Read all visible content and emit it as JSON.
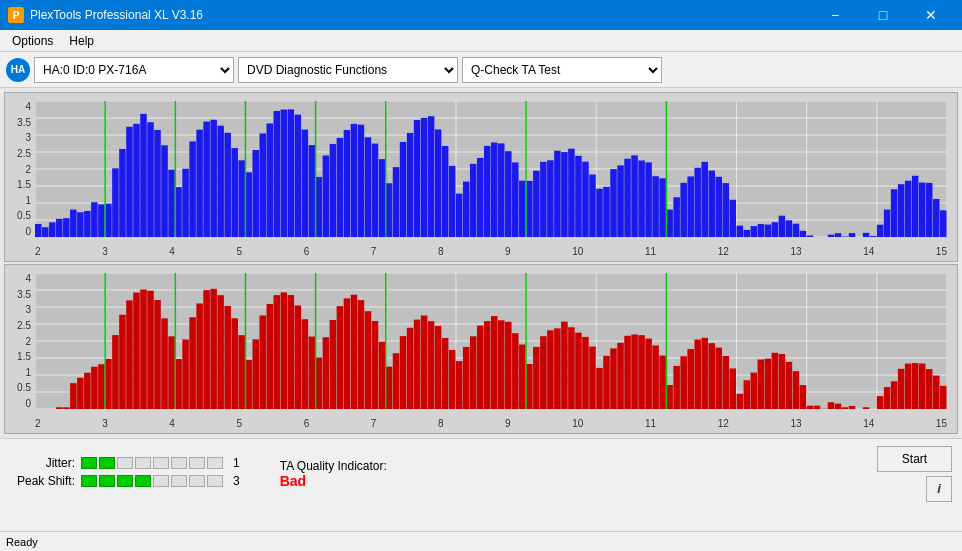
{
  "titleBar": {
    "title": "PlexTools Professional XL V3.16",
    "icon": "P",
    "minimizeLabel": "−",
    "maximizeLabel": "□",
    "closeLabel": "✕"
  },
  "menuBar": {
    "items": [
      "Options",
      "Help"
    ]
  },
  "toolbar": {
    "driveLabel": "HA:0 ID:0  PX-716A",
    "functionLabel": "DVD Diagnostic Functions",
    "testLabel": "Q-Check TA Test"
  },
  "charts": {
    "blue": {
      "yLabels": [
        "4",
        "3.5",
        "3",
        "2.5",
        "2",
        "1.5",
        "1",
        "0.5",
        "0"
      ],
      "xLabels": [
        "2",
        "3",
        "4",
        "5",
        "6",
        "7",
        "8",
        "9",
        "10",
        "11",
        "12",
        "13",
        "14",
        "15"
      ]
    },
    "red": {
      "yLabels": [
        "4",
        "3.5",
        "3",
        "2.5",
        "2",
        "1.5",
        "1",
        "0.5",
        "0"
      ],
      "xLabels": [
        "2",
        "3",
        "4",
        "5",
        "6",
        "7",
        "8",
        "9",
        "10",
        "11",
        "12",
        "13",
        "14",
        "15"
      ]
    }
  },
  "metrics": {
    "jitter": {
      "label": "Jitter:",
      "value": "1",
      "filledSegments": 2,
      "totalSegments": 8
    },
    "peakShift": {
      "label": "Peak Shift:",
      "value": "3",
      "filledSegments": 4,
      "totalSegments": 8
    },
    "taQuality": {
      "label": "TA Quality Indicator:",
      "value": "Bad"
    }
  },
  "buttons": {
    "start": "Start",
    "info": "i"
  },
  "statusBar": {
    "text": "Ready"
  }
}
